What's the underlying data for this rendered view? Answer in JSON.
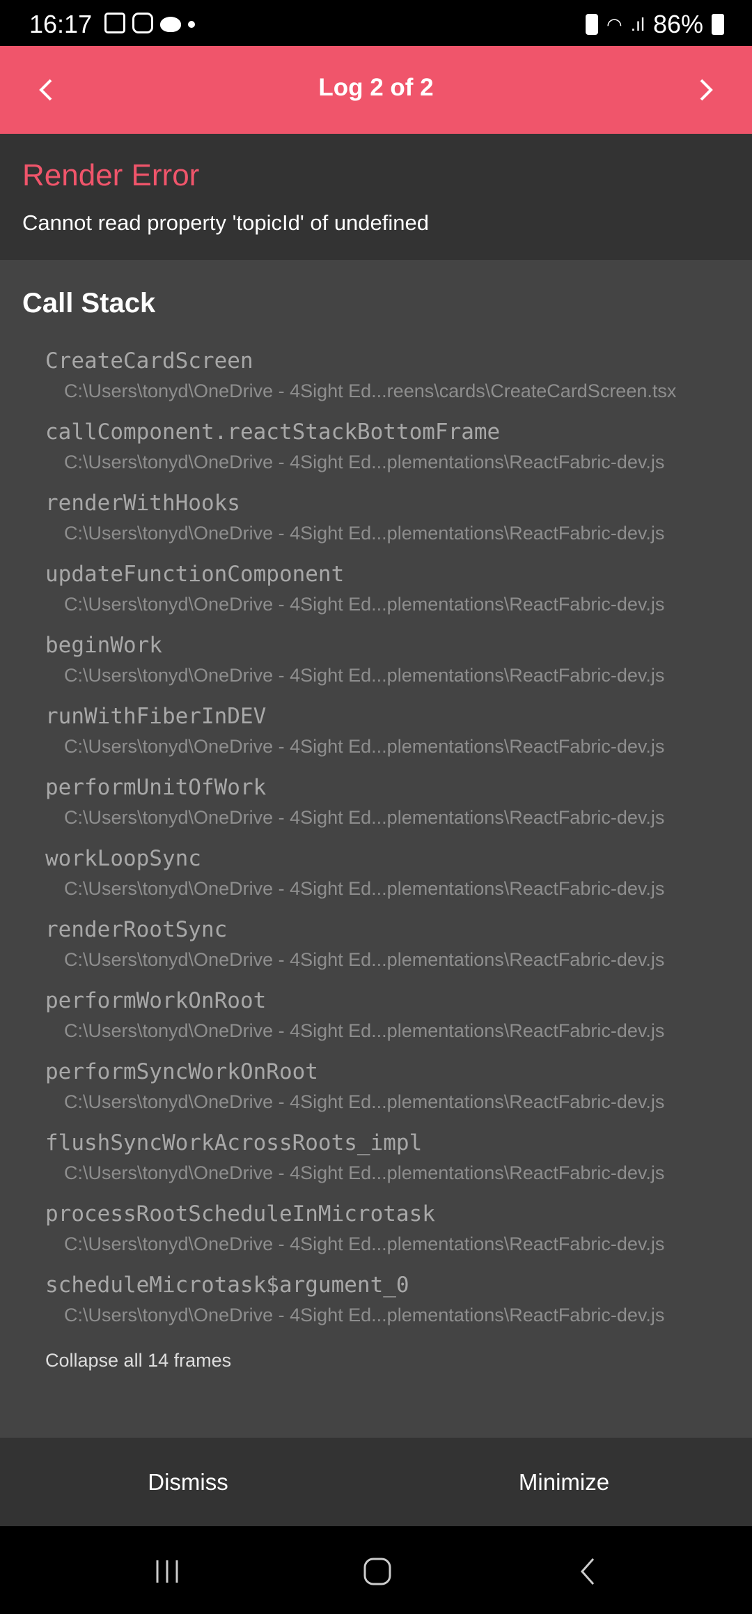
{
  "status_bar": {
    "time": "16:17",
    "battery": "86%"
  },
  "header": {
    "title": "Log 2 of 2"
  },
  "error": {
    "title": "Render Error",
    "message": "Cannot read property 'topicId' of undefined"
  },
  "call_stack": {
    "title": "Call Stack",
    "frames": [
      {
        "name": "CreateCardScreen",
        "path": "C:\\Users\\tonyd\\OneDrive - 4Sight Ed...reens\\cards\\CreateCardScreen.tsx"
      },
      {
        "name": "callComponent.reactStackBottomFrame",
        "path": "C:\\Users\\tonyd\\OneDrive - 4Sight Ed...plementations\\ReactFabric-dev.js"
      },
      {
        "name": "renderWithHooks",
        "path": "C:\\Users\\tonyd\\OneDrive - 4Sight Ed...plementations\\ReactFabric-dev.js"
      },
      {
        "name": "updateFunctionComponent",
        "path": "C:\\Users\\tonyd\\OneDrive - 4Sight Ed...plementations\\ReactFabric-dev.js"
      },
      {
        "name": "beginWork",
        "path": "C:\\Users\\tonyd\\OneDrive - 4Sight Ed...plementations\\ReactFabric-dev.js"
      },
      {
        "name": "runWithFiberInDEV",
        "path": "C:\\Users\\tonyd\\OneDrive - 4Sight Ed...plementations\\ReactFabric-dev.js"
      },
      {
        "name": "performUnitOfWork",
        "path": "C:\\Users\\tonyd\\OneDrive - 4Sight Ed...plementations\\ReactFabric-dev.js"
      },
      {
        "name": "workLoopSync",
        "path": "C:\\Users\\tonyd\\OneDrive - 4Sight Ed...plementations\\ReactFabric-dev.js"
      },
      {
        "name": "renderRootSync",
        "path": "C:\\Users\\tonyd\\OneDrive - 4Sight Ed...plementations\\ReactFabric-dev.js"
      },
      {
        "name": "performWorkOnRoot",
        "path": "C:\\Users\\tonyd\\OneDrive - 4Sight Ed...plementations\\ReactFabric-dev.js"
      },
      {
        "name": "performSyncWorkOnRoot",
        "path": "C:\\Users\\tonyd\\OneDrive - 4Sight Ed...plementations\\ReactFabric-dev.js"
      },
      {
        "name": "flushSyncWorkAcrossRoots_impl",
        "path": "C:\\Users\\tonyd\\OneDrive - 4Sight Ed...plementations\\ReactFabric-dev.js"
      },
      {
        "name": "processRootScheduleInMicrotask",
        "path": "C:\\Users\\tonyd\\OneDrive - 4Sight Ed...plementations\\ReactFabric-dev.js"
      },
      {
        "name": "scheduleMicrotask$argument_0",
        "path": "C:\\Users\\tonyd\\OneDrive - 4Sight Ed...plementations\\ReactFabric-dev.js"
      }
    ],
    "collapse_label": "Collapse all 14 frames"
  },
  "footer": {
    "dismiss": "Dismiss",
    "minimize": "Minimize"
  },
  "colors": {
    "accent": "#f0556b",
    "panel": "#333333",
    "background": "#444444"
  }
}
